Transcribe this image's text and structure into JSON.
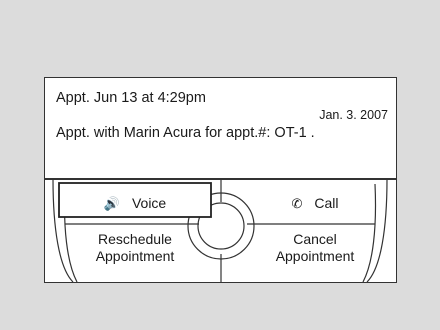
{
  "message": {
    "title": "Appt. Jun  13 at  4:29pm",
    "date": "Jan. 3. 2007",
    "description": "Appt. with Marin Acura for appt.#: OT-1 ."
  },
  "controls": {
    "voice_label": "Voice",
    "voice_icon": "speaker-icon",
    "call_label": "Call",
    "call_icon": "phone-handset-icon",
    "reschedule_line1": "Reschedule",
    "reschedule_line2": "Appointment",
    "cancel_line1": "Cancel",
    "cancel_line2": "Appointment"
  }
}
